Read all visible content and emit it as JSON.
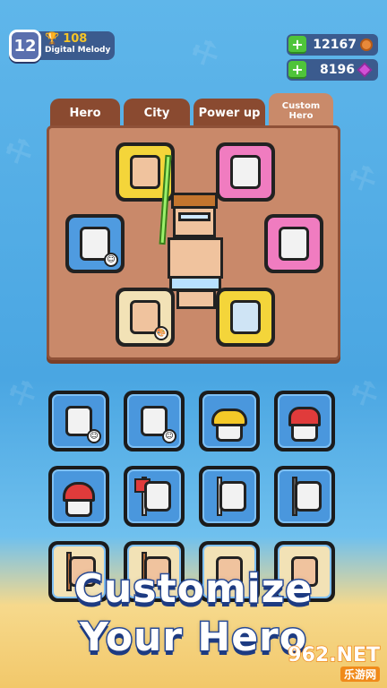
{
  "player": {
    "level": "12",
    "trophies": "108",
    "name": "Digital Melody"
  },
  "resources": {
    "coins": "12167",
    "gems": "8196"
  },
  "tabs": [
    {
      "label": "Hero"
    },
    {
      "label": "City"
    },
    {
      "label": "Power up"
    },
    {
      "label": "Custom Hero",
      "active": true
    }
  ],
  "caption": {
    "line1": "Customize",
    "line2": "Your Hero"
  },
  "watermark": {
    "brand": "962.NET",
    "sub": "乐游网"
  },
  "colors": {
    "accent_green": "#4fc43a",
    "panel_wood": "#c9896a",
    "tab_dark": "#8a4a30",
    "caption_stroke": "#2a4fa0"
  }
}
